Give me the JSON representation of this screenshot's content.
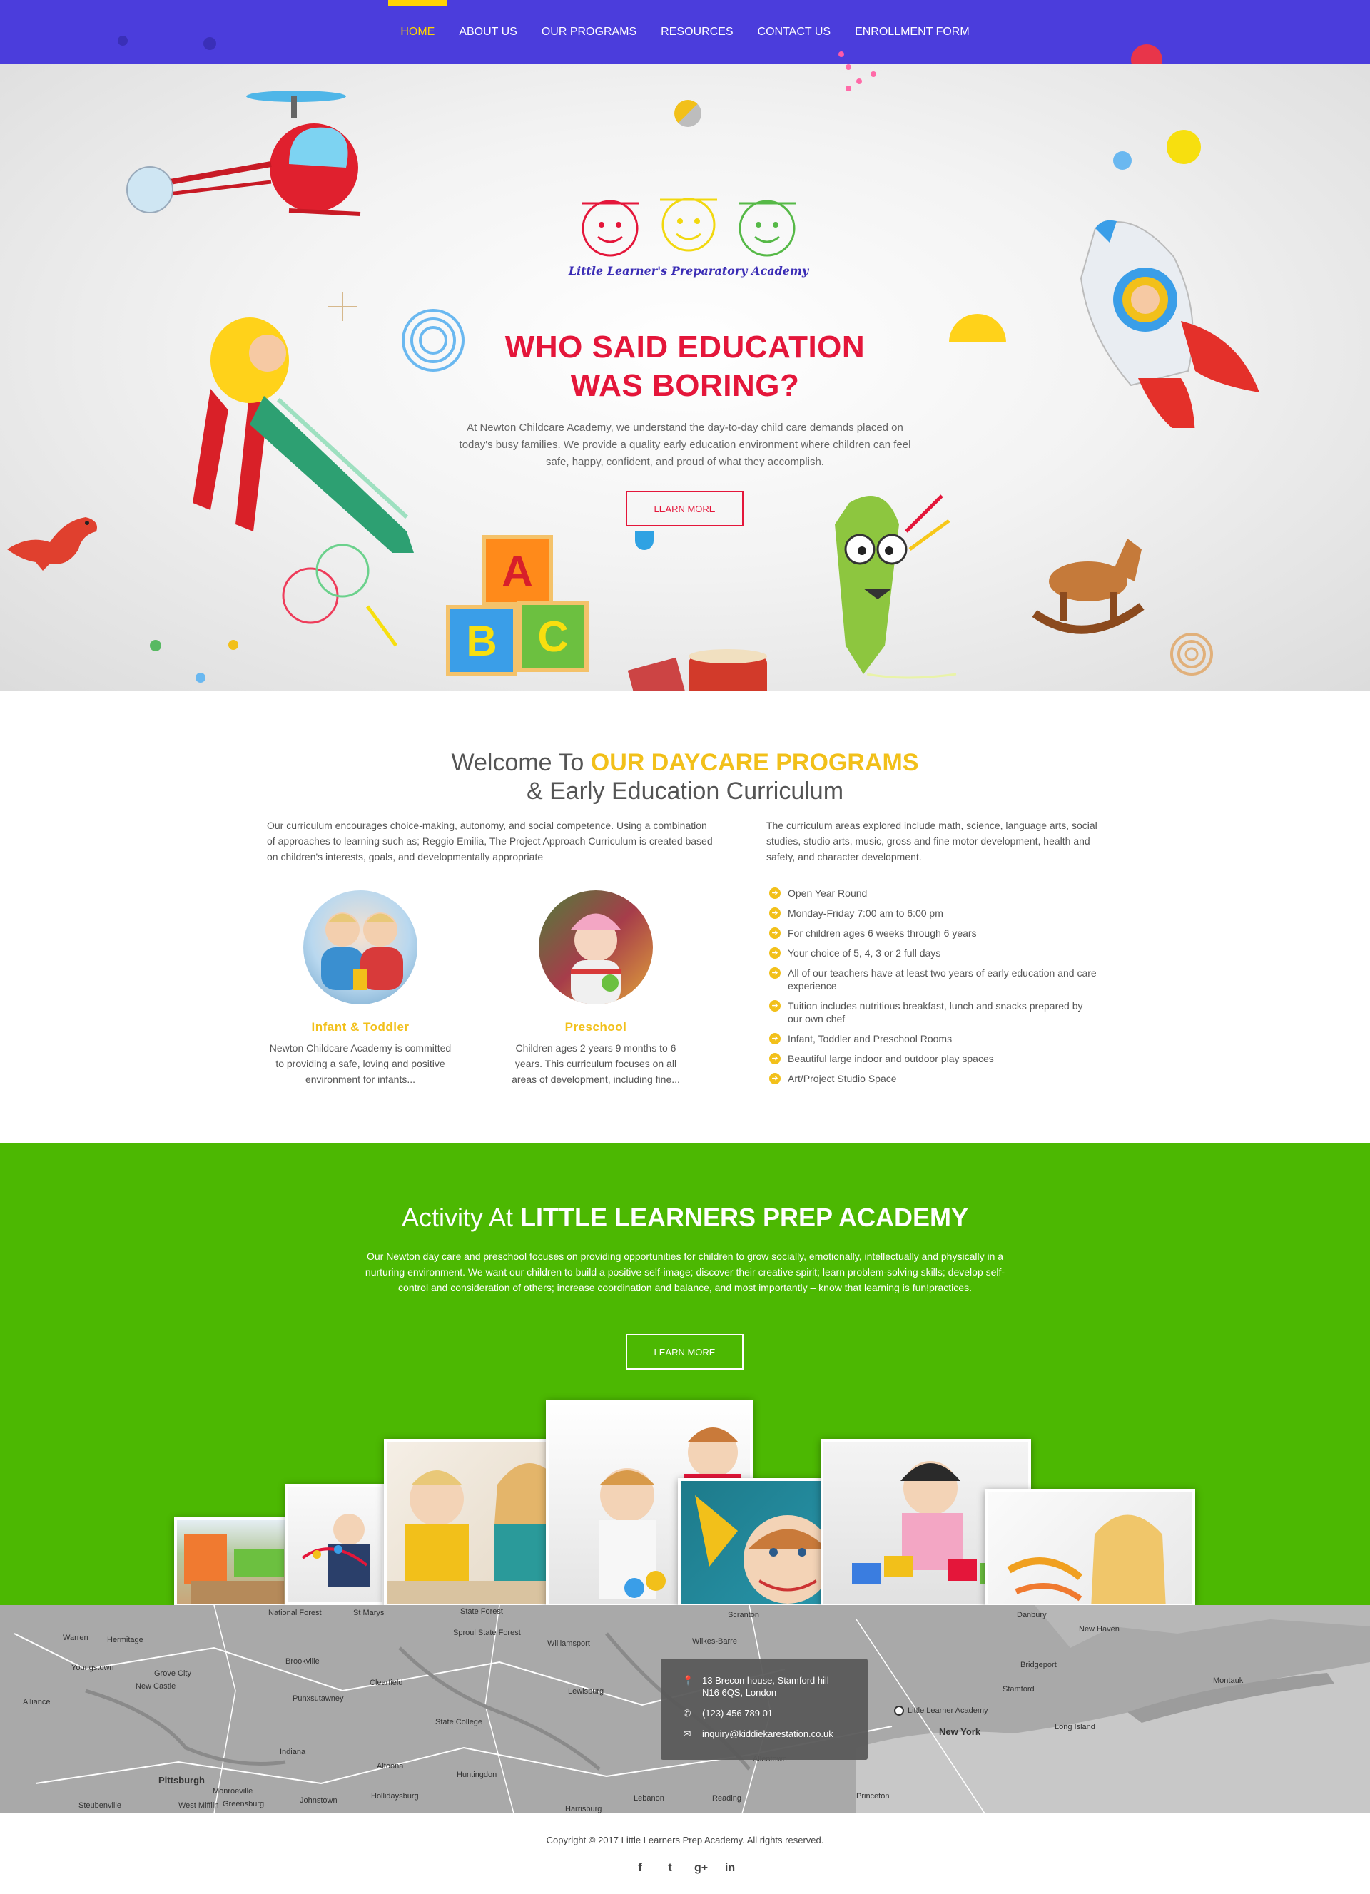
{
  "nav": {
    "items": [
      "HOME",
      "ABOUT US",
      "OUR PROGRAMS",
      "RESOURCES",
      "CONTACT US",
      "ENROLLMENT FORM"
    ],
    "active_index": 0
  },
  "hero": {
    "logo_text": "Little Learner's Preparatory Academy",
    "blocks": [
      "A",
      "B",
      "C"
    ],
    "title_line1": "WHO SAID EDUCATION",
    "title_line2": "WAS BORING?",
    "text": "At Newton Childcare Academy, we understand the day-to-day child care demands placed on today's busy families. We provide a quality early education environment where children can feel safe, happy, confident, and proud of what they accomplish.",
    "button": "LEARN MORE"
  },
  "programs": {
    "title_prefix": "Welcome To ",
    "title_highlight": "OUR DAYCARE PROGRAMS",
    "title_line2": "& Early Education Curriculum",
    "left_text": "Our curriculum encourages choice-making, autonomy, and social competence. Using a combination of approaches to learning such as; Reggio Emilia, The Project Approach Curriculum is created based on children's interests, goals, and developmentally appropriate",
    "right_text": "The curriculum areas explored include math, science, language arts, social studies, studio arts, music, gross and fine motor development, health and safety, and character development.",
    "cards": [
      {
        "title": "Infant & Toddler",
        "text": "Newton Childcare Academy is committed to providing a safe, loving and positive environment for infants..."
      },
      {
        "title": "Preschool",
        "text": "Children ages 2 years 9 months to 6 years. This curriculum focuses on all areas of development, including fine..."
      }
    ],
    "features": [
      "Open Year Round",
      "Monday-Friday 7:00 am to 6:00 pm",
      "For children ages 6 weeks through 6 years",
      "Your choice of 5, 4, 3 or 2 full days",
      "All of our teachers have at least two years of early education and care experience",
      "Tuition includes nutritious breakfast, lunch and snacks prepared by our own chef",
      "Infant, Toddler and Preschool Rooms",
      "Beautiful large indoor and outdoor play spaces",
      "Art/Project Studio Space"
    ],
    "check_icon": "check-circle-icon"
  },
  "activity": {
    "title_prefix": "Activity At ",
    "title_bold": "LITTLE LEARNERS PREP ACADEMY",
    "text": "Our Newton day care and preschool focuses on providing opportunities for children to grow socially, emotionally, intellectually and physically in a nurturing environment. We want our children to build a positive self-image; discover their creative spirit; learn problem-solving skills; develop self-control and consideration of others; increase coordination and balance, and most importantly – know that learning is fun!practices.",
    "button": "LEARN MORE"
  },
  "map": {
    "labels": [
      "National Forest",
      "St Marys",
      "State Forest",
      "Scranton",
      "Danbury",
      "New Haven",
      "Warren",
      "Hermitage",
      "Youngstown",
      "Grove City",
      "Brookville",
      "Sproul State Forest",
      "Williamsport",
      "Wilkes-Barre",
      "Bridgeport",
      "Stamford",
      "Montauk",
      "New Castle",
      "Clearfield",
      "Lewisburg",
      "Alliance",
      "Punxsutawney",
      "State College",
      "Little Learner Academy",
      "New York",
      "Long Island",
      "Indiana",
      "Altoona",
      "Huntingdon",
      "Allentown",
      "Pittsburgh",
      "Monroeville",
      "Steubenville",
      "West Mifflin",
      "Greensburg",
      "Johnstown",
      "Hollidaysburg",
      "Lebanon",
      "Reading",
      "Harrisburg",
      "Princeton"
    ],
    "contact": {
      "address_line1": "13 Brecon house, Stamford hill",
      "address_line2": "N16 6QS, London",
      "phone": "(123) 456 789 01",
      "email": "inquiry@kiddiekarestation.co.uk"
    }
  },
  "footer": {
    "copyright": "Copyright © 2017 Little Learners Prep Academy. All rights reserved.",
    "social": [
      {
        "name": "facebook-icon",
        "glyph": "f"
      },
      {
        "name": "twitter-icon",
        "glyph": "t"
      },
      {
        "name": "google-plus-icon",
        "glyph": "g+"
      },
      {
        "name": "linkedin-icon",
        "glyph": "in"
      }
    ]
  },
  "colors": {
    "nav_bg": "#4b3ddc",
    "accent_yellow": "#f2c01a",
    "hero_red": "#e4163a",
    "activity_green": "#4cb802"
  }
}
